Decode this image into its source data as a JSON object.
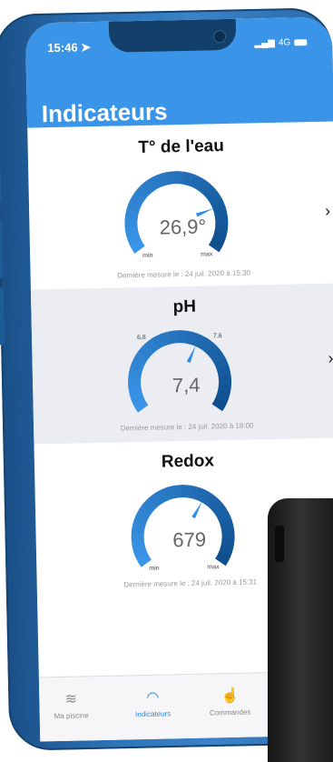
{
  "status": {
    "time": "15:46",
    "network": "4G"
  },
  "header": {
    "title": "Indicateurs"
  },
  "indicators": [
    {
      "title": "T° de l'eau",
      "value": "26,9°",
      "min_label": "min",
      "max_label": "max",
      "last_measure": "Dernière mesure le : 24 juil. 2020 à 15:30",
      "level": 0.78
    },
    {
      "title": "pH",
      "value": "7,4",
      "low_label": "6,8",
      "high_label": "7,6",
      "last_measure": "Dernière mesure le : 24 juil. 2020 à 18:00",
      "level": 0.6
    },
    {
      "title": "Redox",
      "value": "679",
      "min_label": "min",
      "max_label": "max",
      "last_measure": "Dernière mesure le : 24 juil. 2020 à 15:31",
      "level": 0.62
    }
  ],
  "tabs": [
    {
      "label": "Ma piscine",
      "icon": "pool-icon"
    },
    {
      "label": "Indicateurs",
      "icon": "gauge-icon"
    },
    {
      "label": "Commandes",
      "icon": "hand-pointer-icon"
    }
  ],
  "colors": {
    "header": "#3a95e8",
    "gauge_light": "#3a95e8",
    "gauge_dark": "#0f4f8e",
    "tab_active": "#2a86e2"
  }
}
